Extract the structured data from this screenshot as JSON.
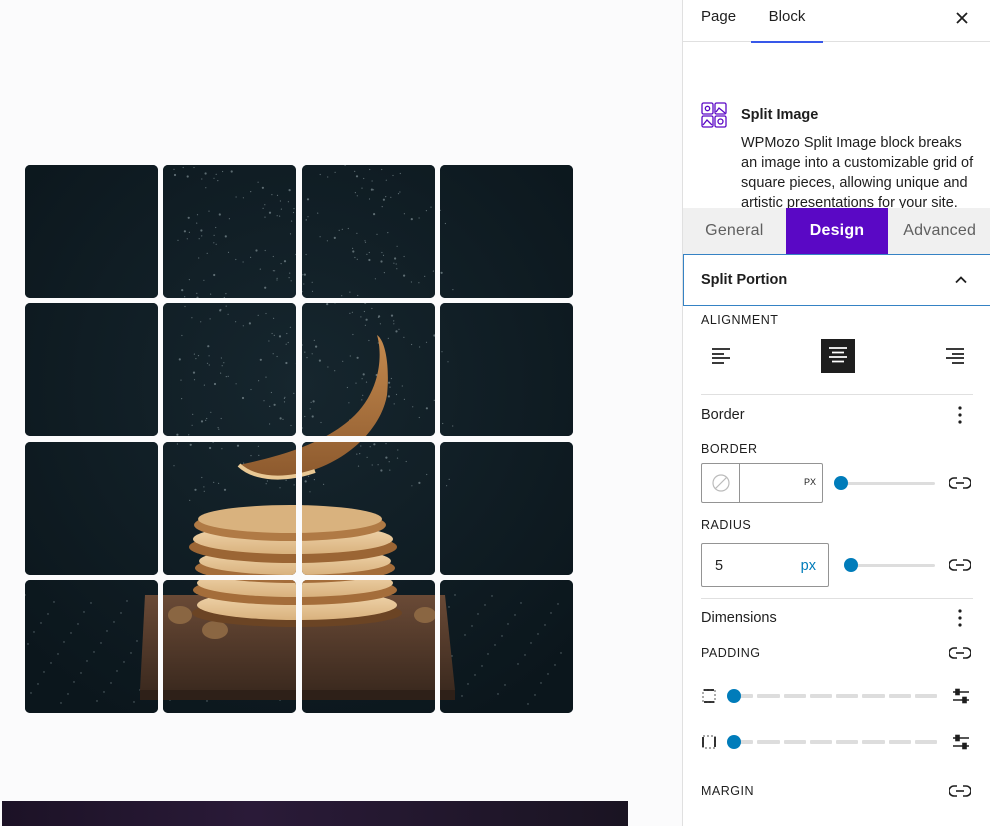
{
  "header": {
    "tabs": [
      "Page",
      "Block"
    ],
    "active_tab": "Block",
    "close_icon": "close-icon"
  },
  "block_info": {
    "icon": "split-image-icon",
    "title": "Split Image",
    "description": "WPMozo Split Image block breaks an image into a customizable grid of square pieces, allowing unique and artistic presentations for your site."
  },
  "panel_tabs": {
    "items": [
      "General",
      "Design",
      "Advanced"
    ],
    "active": "Design"
  },
  "split_portion": {
    "title": "Split Portion",
    "expanded": true,
    "alignment_label": "ALIGNMENT",
    "alignment_selected": "center"
  },
  "border": {
    "title": "Border",
    "border_label": "BORDER",
    "border_unit": "PX",
    "border_slider_value": 0,
    "radius_label": "RADIUS",
    "radius_value": "5",
    "radius_unit": "px",
    "radius_slider_value": 5
  },
  "dimensions": {
    "title": "Dimensions",
    "padding_label": "PADDING",
    "margin_label": "MARGIN",
    "padding_vertical_value": 0,
    "padding_horizontal_value": 0
  },
  "canvas": {
    "grid_rows": 4,
    "grid_cols": 4,
    "tile_radius_px": 5,
    "image_subject": "pancakes"
  },
  "colors": {
    "accent_purple": "#5a08c5",
    "wp_blue": "#007cba",
    "tab_underline": "#3858e9",
    "section_border": "#3582c4"
  }
}
